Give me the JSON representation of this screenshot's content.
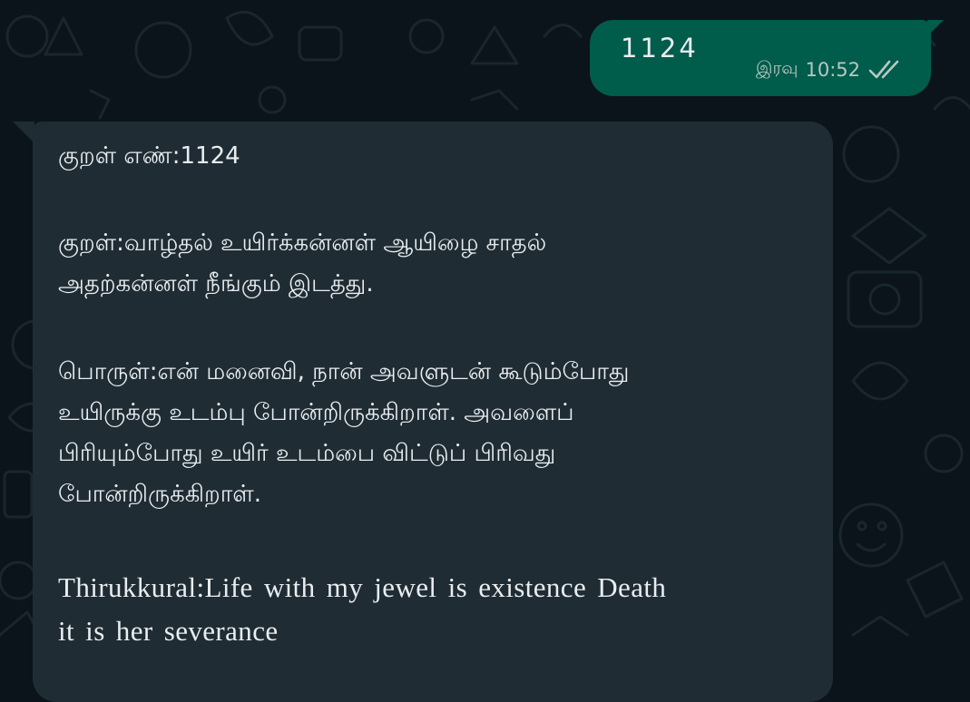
{
  "colors": {
    "background": "#0b141a",
    "outgoing_bubble": "#005c4b",
    "incoming_bubble": "#1f2c34",
    "text": "#e9edef",
    "meta_text": "#b6c9c3",
    "doodle": "#1a262d"
  },
  "sent_message": {
    "text": "1124",
    "period": "இரவு",
    "time": "10:52",
    "status_icon": "double-check-icon"
  },
  "received_message": {
    "number_line": "குறள் எண்:1124",
    "kural_lines": [
      "குறள்:வாழ்தல் உயிர்க்கன்னள் ஆயிழை சாதல்",
      "அதற்கன்னள் நீங்கும் இடத்து."
    ],
    "meaning_lines": [
      "பொருள்:என் மனைவி, நான் அவளுடன் கூடும்போது",
      "உயிருக்கு உடம்பு போன்றிருக்கிறாள். அவளைப்",
      "பிரியும்போது உயிர் உடம்பை விட்டுப் பிரிவது",
      "போன்றிருக்கிறாள்."
    ],
    "english_lines": [
      "Thirukkural:Life with my jewel is existence Death",
      "it is her severance"
    ]
  }
}
